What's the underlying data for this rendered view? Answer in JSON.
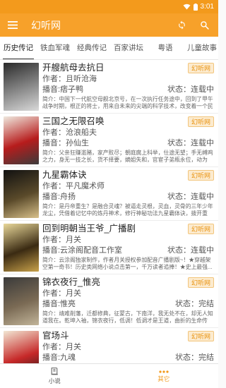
{
  "status_bar": {
    "time": "3:01",
    "icons": [
      "wifi-icon",
      "battery-icon"
    ]
  },
  "app_bar": {
    "title": "幻听网",
    "menu_icon": "hamburger-icon",
    "actions": [
      "refresh-icon",
      "search-icon"
    ]
  },
  "tabs": [
    {
      "label": "历史传记",
      "active": true
    },
    {
      "label": "铁血军魂",
      "active": false
    },
    {
      "label": "经典传记",
      "active": false
    },
    {
      "label": "百家讲坛",
      "active": false
    },
    {
      "label": "粤语",
      "active": false
    },
    {
      "label": "儿童故事",
      "active": false
    }
  ],
  "books": [
    {
      "title": "开艘航母去抗日",
      "tag": "幻听网",
      "author": "作者：且听沧海",
      "narrator": "播音:痞子鸭",
      "status": "状态：连载中",
      "intro": "简介：中国下一代航空母舰北京号，在一次执行任务途中，回到了甲午战争时期，根正的将士，用来自未来的尖端的科学技术，改变着一个民族的命运。",
      "cover_colors": [
        "#2a2a2a",
        "#8a8a8a",
        "#d9d9d9"
      ]
    },
    {
      "title": "三国之无限召唤",
      "tag": "幻听网",
      "author": "作者：沧浪船夫",
      "narrator": "播音：孙仙生",
      "status": "状态：连载中",
      "intro": "简介：父亲狂赚滥赌，家产败尽；朝庭腐上科举，仕途无望；手无缚鸡之力，身无一技之长，货不择要，嫡姐失和，官宦子弟瓶永位，动为失...",
      "cover_colors": [
        "#efe9df",
        "#b71c1c",
        "#3b3b3b"
      ]
    },
    {
      "title": "九星霸体诀",
      "tag": "幻听网",
      "author": "作者：平凡魔术师",
      "narrator": "播音:舟扬",
      "status": "状态：连载中",
      "intro": "简介：是丹帝重生？是融合灵魂？被逼走灵根，灵血，灵骨的三年少年龙尘，凭借着记忆中的炼丹神术，修行神秘功法九星霸体诀，拨开重重...",
      "cover_colors": [
        "#111111",
        "#5a4a2a",
        "#d8c08a"
      ]
    },
    {
      "title": "回到明朝当王爷_广播剧",
      "tag": "幻听网",
      "author": "作者：月关",
      "narrator": "播音:云涂阁配音工作室",
      "status": "状态：连载中",
      "intro": "简介：云涂阁独家制作，作者月关授权参加配音广播剧版~！★穿越架空第一奇书！历史类网络小说点击第一，千万读者追捧！★史上最强...",
      "cover_colors": [
        "#e9d89a",
        "#3a2a12",
        "#c9a24a"
      ]
    },
    {
      "title": "锦衣夜行_惟亮",
      "tag": "幻听网",
      "author": "作者：月关",
      "narrator": "播音:惟亮",
      "status": "状态：完结",
      "intro": "简介：靖难削藩，迁都修典，征蒙古，下南洋，我无处不在，却无人知道我在。乾坤入袖，锦衣夜行，低调！低调才是王道，曲折的生命传承。",
      "cover_colors": [
        "#3a3a3a",
        "#7a6a54",
        "#c2b59a"
      ]
    },
    {
      "title": "官场斗",
      "tag": "幻听网",
      "author": "作者：月关",
      "narrator": "播音:九魂",
      "status": "状态：完结",
      "intro": "",
      "cover_colors": [
        "#f2e7d4",
        "#c62828",
        "#1a1a1a"
      ]
    }
  ],
  "bottom_nav": [
    {
      "label": "小说",
      "icon": "book-icon",
      "active": false
    },
    {
      "label": "其它",
      "icon": "more-dots-icon",
      "active": true
    }
  ],
  "colors": {
    "accent": "#f7a12a",
    "tag_bg": "#fcebcf",
    "tag_text": "#e9920e"
  }
}
